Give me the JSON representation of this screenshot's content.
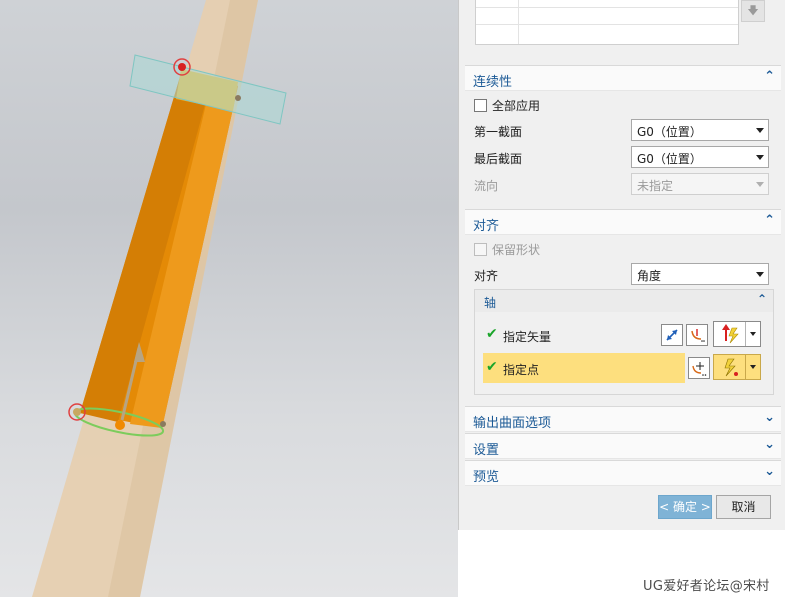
{
  "table": {
    "scroll_down_icon": "arrow-down-icon"
  },
  "continuity": {
    "title": "连续性",
    "apply_all_label": "全部应用",
    "apply_all_checked": false,
    "first_section_label": "第一截面",
    "first_section_value": "G0（位置）",
    "last_section_label": "最后截面",
    "last_section_value": "G0（位置）",
    "flow_label": "流向",
    "flow_value": "未指定"
  },
  "alignment": {
    "title": "对齐",
    "preserve_shape_label": "保留形状",
    "preserve_shape_checked": false,
    "align_label": "对齐",
    "align_value": "角度",
    "axis": {
      "title": "轴",
      "specify_vector_label": "指定矢量",
      "specify_point_label": "指定点"
    }
  },
  "sections": {
    "output_options": "输出曲面选项",
    "settings": "设置",
    "preview": "预览"
  },
  "buttons": {
    "ok": "< 确定 >",
    "cancel": "取消"
  },
  "watermark": "UG爱好者论坛@宋村",
  "colors": {
    "accent": "#1c5a96",
    "highlight": "#fddf7e",
    "ok_button": "#7fb3d6",
    "check": "#1aa52a",
    "solid": "#e48a06",
    "rod": "#e6cfb0"
  }
}
